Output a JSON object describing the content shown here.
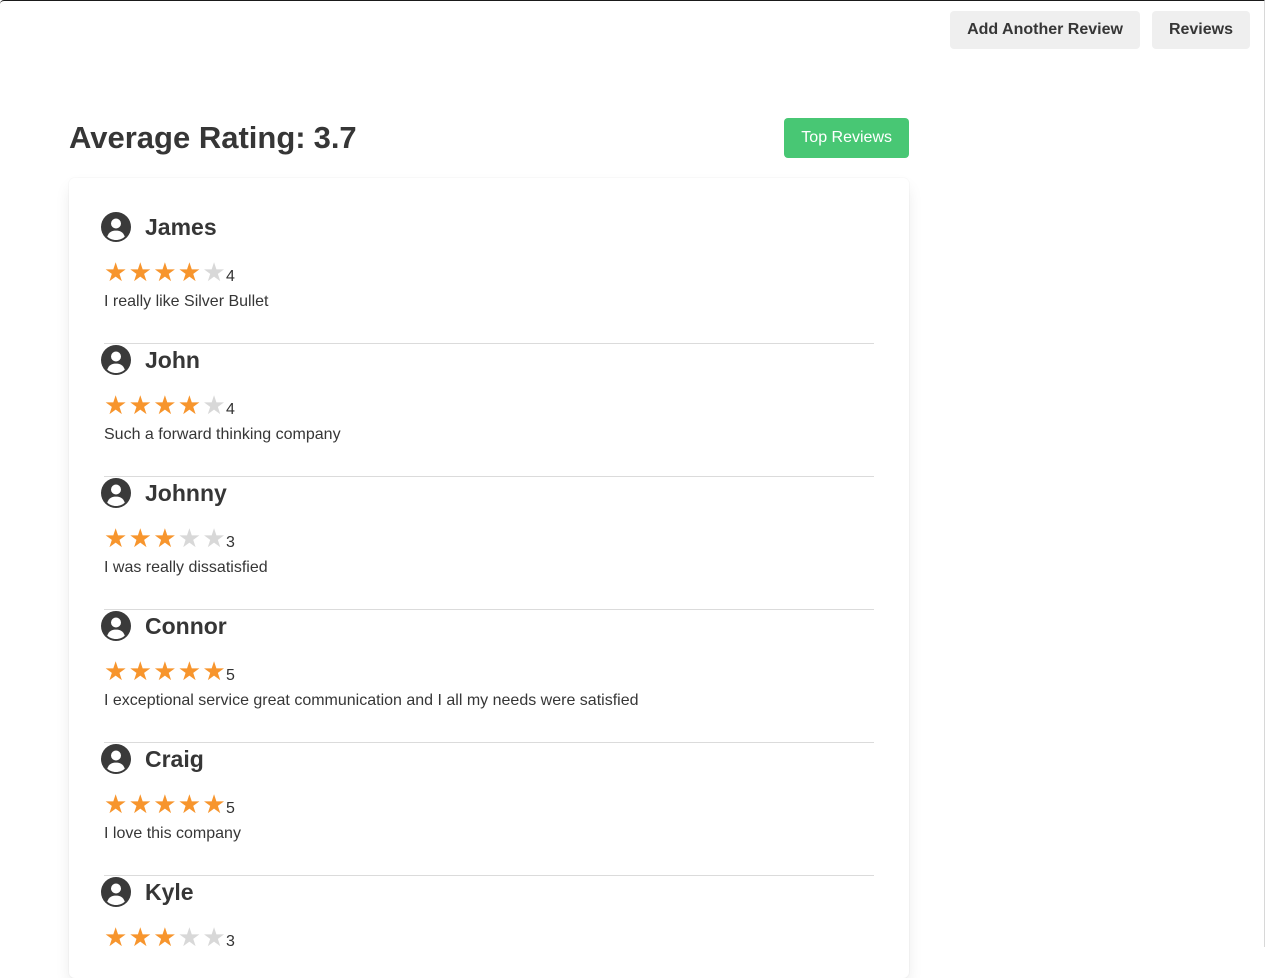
{
  "nav": {
    "add_review_label": "Add Another Review",
    "reviews_label": "Reviews"
  },
  "header": {
    "title": "Average Rating:",
    "average": "3.7",
    "top_reviews_label": "Top Reviews"
  },
  "colors": {
    "star_filled": "#f7952d",
    "star_empty": "#d8d8d8",
    "accent_green": "#48c774",
    "icon": "#3a3a3a"
  },
  "reviews": [
    {
      "name": "James",
      "rating": 4,
      "text": "I really like Silver Bullet"
    },
    {
      "name": "John",
      "rating": 4,
      "text": "Such a forward thinking company"
    },
    {
      "name": "Johnny",
      "rating": 3,
      "text": "I was really dissatisfied"
    },
    {
      "name": "Connor",
      "rating": 5,
      "text": "I exceptional service great communication and I all my needs were satisfied"
    },
    {
      "name": "Craig",
      "rating": 5,
      "text": "I love this company"
    },
    {
      "name": "Kyle",
      "rating": 3,
      "text": ""
    }
  ]
}
